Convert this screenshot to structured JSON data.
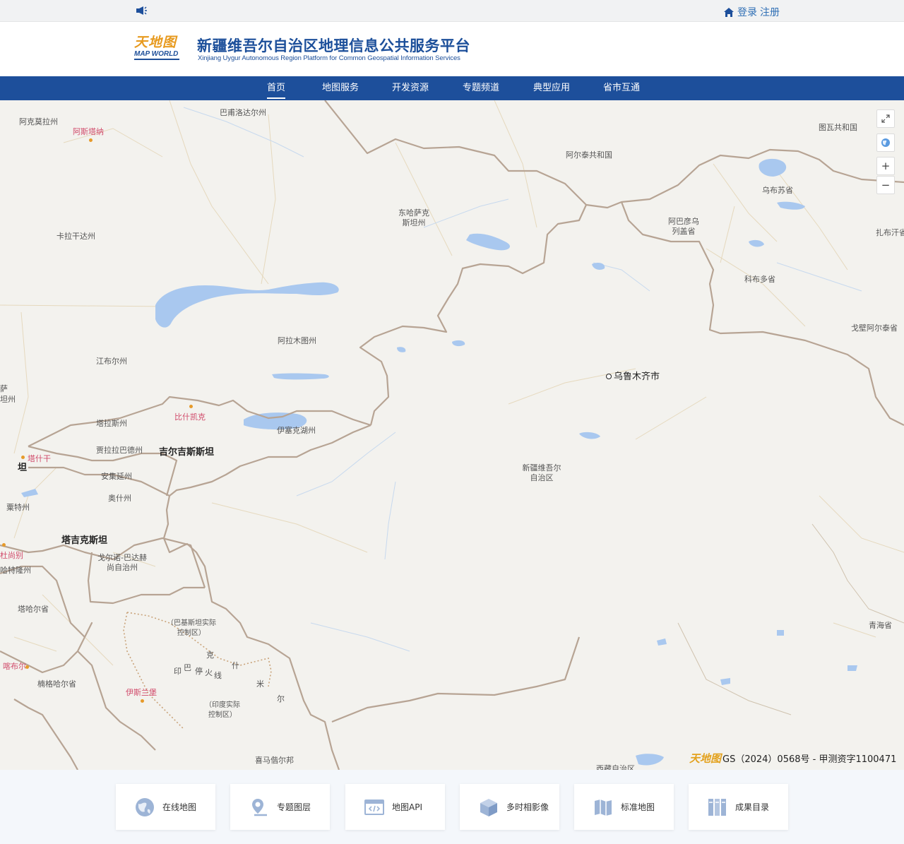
{
  "topbar": {
    "login_label": "登录",
    "register_label": "注册"
  },
  "header": {
    "logo_cn": "天地图",
    "logo_en": "MAP WORLD",
    "title": "新疆维吾尔自治区地理信息公共服务平台",
    "subtitle": "Xinjiang Uygur Autonomous Region Platform for Common Geospatial Information Services"
  },
  "nav": {
    "items": [
      "首页",
      "地图服务",
      "开发资源",
      "专题频道",
      "典型应用",
      "省市互通"
    ],
    "active": "首页"
  },
  "map": {
    "labels": {
      "akmola": "阿克莫拉州",
      "astana": "阿斯塔纳",
      "pavlodar": "巴甫洛达尔州",
      "tuva": "图瓦共和国",
      "altai_rep": "阿尔泰共和国",
      "uvs": "乌布苏省",
      "east_kaz": "东哈萨克斯坦州",
      "karaganda": "卡拉干达州",
      "bayan_olgii": "阿巴彦乌列盖省",
      "zavkhan": "扎布汗省",
      "khovd": "科布多省",
      "almaty_reg": "阿拉木图州",
      "govi_altai": "戈壁阿尔泰省",
      "urumqi": "乌鲁木齐市",
      "zhambyl": "江布尔州",
      "talas": "塔拉斯州",
      "bishkek": "比什凯克",
      "issyk": "伊塞克湖州",
      "jalal": "贾拉拉巴德州",
      "kyrgyzstan": "吉尔吉斯斯坦",
      "tashkent": "塔什干",
      "naryn": "安集延州",
      "osh": "奥什州",
      "xinjiang": "新疆维吾尔自治区",
      "sughd": "粟特州",
      "tajikistan": "塔吉克斯坦",
      "dushanbe": "杜尚别",
      "gbao": "戈尔诺-巴达赫尚自治州",
      "khatlon": "哈特隆州",
      "takhar": "塔哈尔省",
      "pak_control": "（巴基斯坦实际控制区）",
      "qinghai": "青海省",
      "kabul": "喀布尔",
      "nangarhar": "楠格哈尔省",
      "islamabad": "伊斯兰堡",
      "ind_control": "（印度实际控制区）",
      "himachal": "喜马偕尔邦",
      "tibet": "西藏自治区",
      "kz_fragment": "坦",
      "kashmir_line": [
        "克",
        "什",
        "米",
        "尔",
        "印",
        "巴",
        "停",
        "火",
        "线"
      ],
      "left_edge_top": "萨",
      "left_edge_bottom": "坦州"
    },
    "copyright_logo": "天地图",
    "copyright": "GS（2024）0568号 - 甲测资字1100471",
    "controls": [
      "fullscreen-icon",
      "globe-icon",
      "zoom-in-icon",
      "zoom-out-icon"
    ],
    "zoom_in": "+",
    "zoom_out": "−"
  },
  "cards": [
    {
      "label": "在线地图",
      "icon": "globe-icon"
    },
    {
      "label": "专题图层",
      "icon": "map-pin-icon"
    },
    {
      "label": "地图API",
      "icon": "code-window-icon"
    },
    {
      "label": "多时相影像",
      "icon": "cube-icon"
    },
    {
      "label": "标准地图",
      "icon": "folded-map-icon"
    },
    {
      "label": "成果目录",
      "icon": "catalog-icon"
    }
  ],
  "colors": {
    "brand_blue": "#1d4f9b",
    "link_blue": "#2f6fb5",
    "logo_orange": "#e79a1f",
    "border_line": "#b7a494",
    "water": "#a9c8ef"
  }
}
